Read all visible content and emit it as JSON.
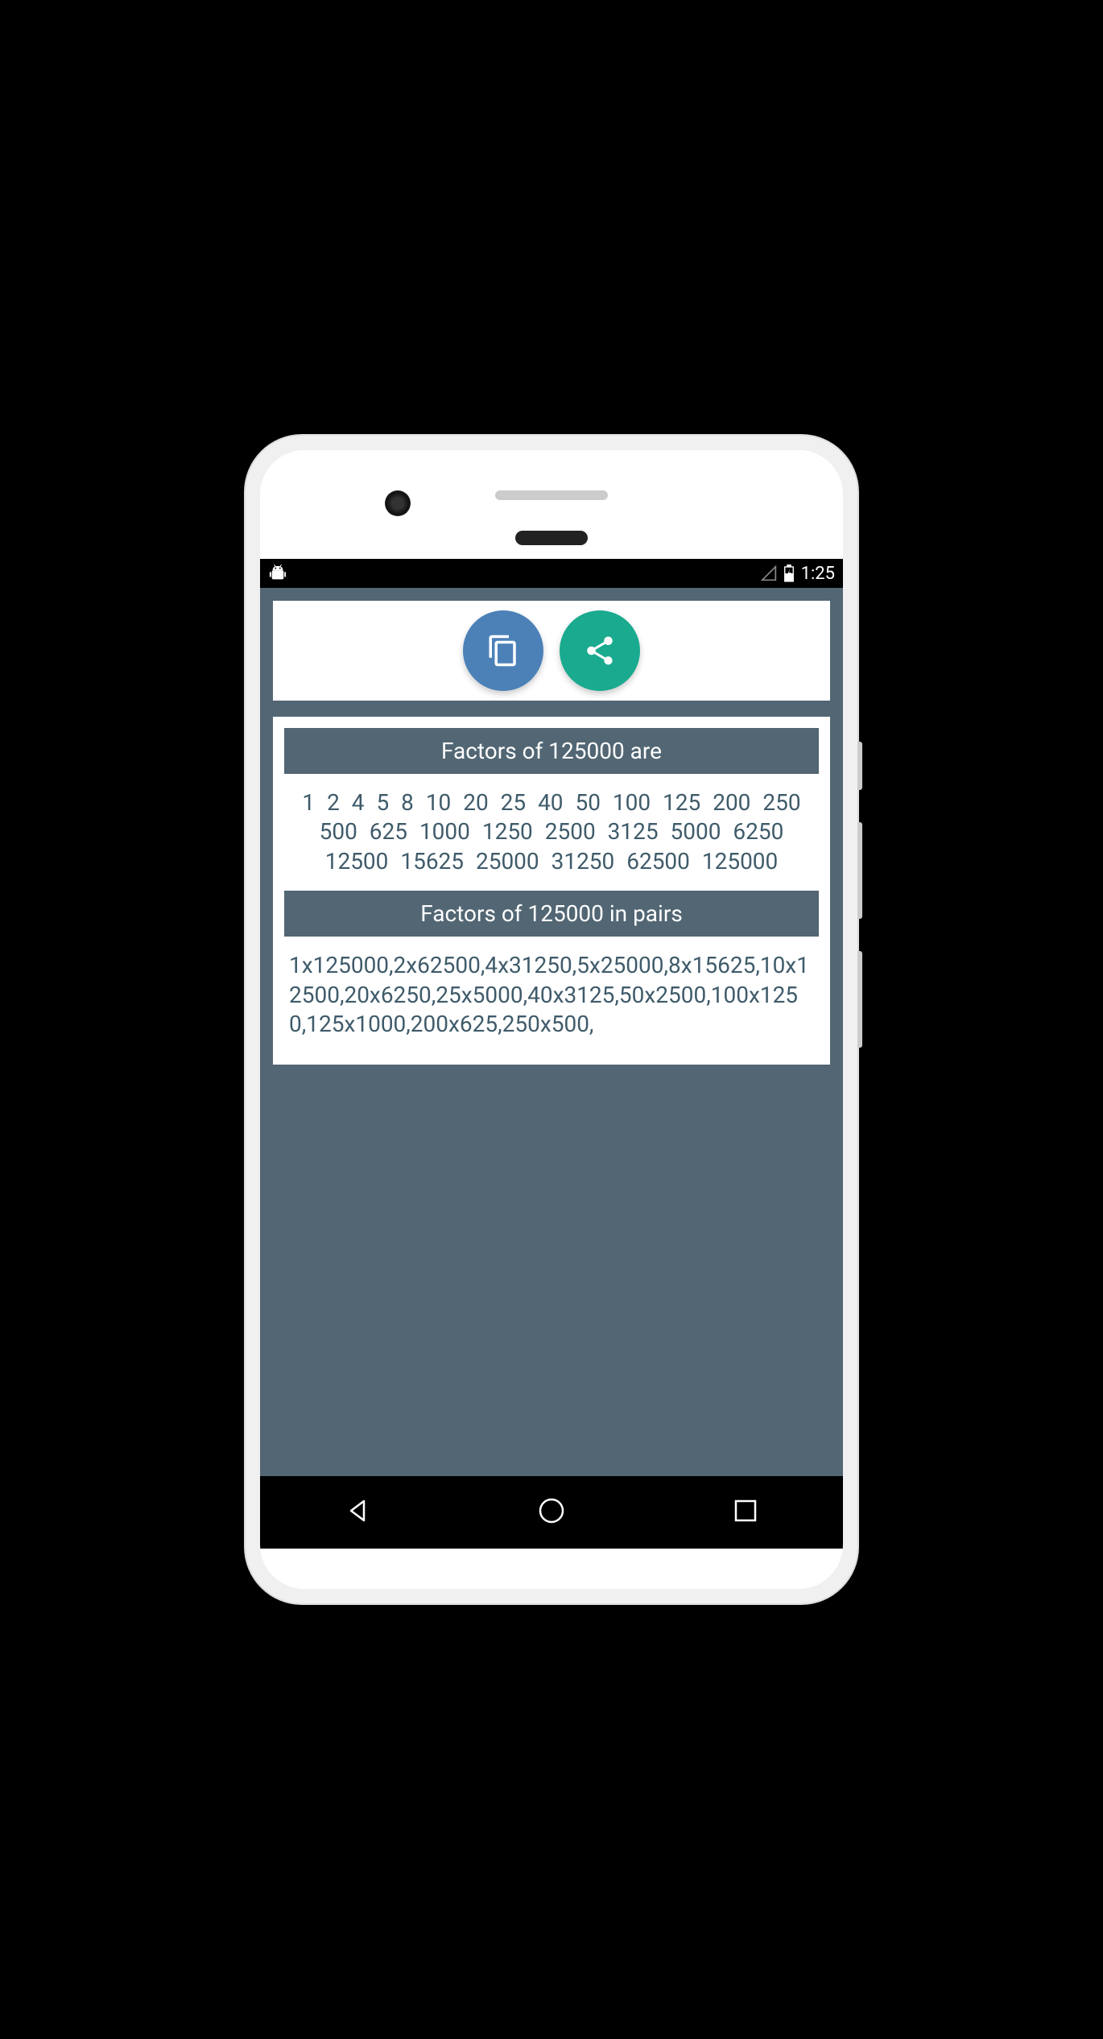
{
  "statusBar": {
    "time": "1:25"
  },
  "toolbar": {
    "copyLabel": "Copy",
    "shareLabel": "Share"
  },
  "sections": {
    "factorsHeader": "Factors of 125000 are",
    "factorsList": "1  2  4  5  8  10  20  25  40  50  100  125  200  250  500  625  1000  1250  2500  3125  5000  6250  12500  15625  25000  31250  62500  125000",
    "pairsHeader": "Factors of 125000 in pairs",
    "pairsList": "1x125000,2x62500,4x31250,5x25000,8x15625,10x12500,20x6250,25x5000,40x3125,50x2500,100x1250,125x1000,200x625,250x500,"
  },
  "factors": [
    1,
    2,
    4,
    5,
    8,
    10,
    20,
    25,
    40,
    50,
    100,
    125,
    200,
    250,
    500,
    625,
    1000,
    1250,
    2500,
    3125,
    5000,
    6250,
    12500,
    15625,
    25000,
    31250,
    62500,
    125000
  ],
  "factorPairs": [
    [
      1,
      125000
    ],
    [
      2,
      62500
    ],
    [
      4,
      31250
    ],
    [
      5,
      25000
    ],
    [
      8,
      15625
    ],
    [
      10,
      12500
    ],
    [
      20,
      6250
    ],
    [
      25,
      5000
    ],
    [
      40,
      3125
    ],
    [
      50,
      2500
    ],
    [
      100,
      1250
    ],
    [
      125,
      1000
    ],
    [
      200,
      625
    ],
    [
      250,
      500
    ]
  ],
  "number": 125000
}
